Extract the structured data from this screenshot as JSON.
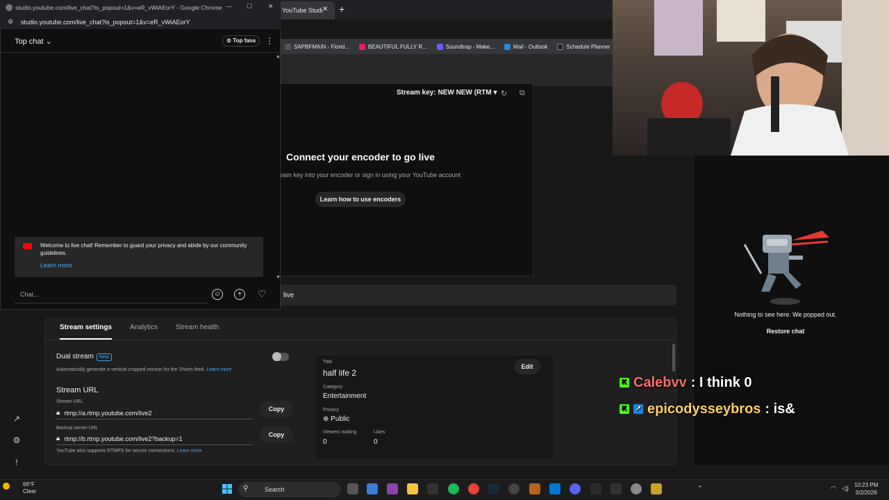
{
  "browser": {
    "tab_label": "YouTube Studi",
    "bookmarks": [
      {
        "label": "SAPBFMAIN - Florid...",
        "color": ""
      },
      {
        "label": "BEAUTIFUL FULLY R...",
        "color": "#e91e63"
      },
      {
        "label": "Soundtrap - Make...",
        "color": "#6a5cff"
      },
      {
        "label": "Mail - Outlook",
        "color": "#1e88e5"
      },
      {
        "label": "Schedule Planner",
        "color": "#222"
      }
    ]
  },
  "studio": {
    "stream_key": "Stream key: NEW NEW (RTM",
    "connect_title": "Connect your encoder to go live",
    "connect_sub": "te a stream key into your encoder or sign in using your YouTube account",
    "learn_encoders": "Learn how to use encoders",
    "golive_text": "live",
    "tabs": {
      "settings": "Stream settings",
      "analytics": "Analytics",
      "health": "Stream health"
    },
    "dual_stream": {
      "label": "Dual stream",
      "badge": "New",
      "desc": "Automatically generate a vertical cropped version for the Shorts feed.",
      "learn_more": "Learn more"
    },
    "stream_url": {
      "heading": "Stream URL",
      "field_label": "Stream URL",
      "value": "rtmp://a.rtmp.youtube.com/live2",
      "copy": "Copy",
      "backup_label": "Backup server URL",
      "backup_value": "rtmp://b.rtmp.youtube.com/live2?backup=1",
      "backup_copy": "Copy",
      "rtmps_note": "YouTube also supports RTMPS for secure connections.",
      "rtmps_link": "Learn more"
    },
    "info": {
      "title_label": "Title",
      "title": "half life 2",
      "edit": "Edit",
      "category_label": "Category",
      "category": "Entertainment",
      "privacy_label": "Privacy",
      "privacy": "Public",
      "viewers_label": "Viewers waiting",
      "viewers": "0",
      "likes_label": "Likes",
      "likes": "0"
    }
  },
  "right_chat": {
    "empty_text": "Nothing to see here. We popped out.",
    "restore": "Restore chat"
  },
  "overlay_chat": [
    {
      "user": "Calebvv",
      "message": ": I think 0",
      "user_color": "#ff6b6b"
    },
    {
      "user": "epicodysseybros",
      "message": ": is&",
      "user_color": "#ffd166"
    }
  ],
  "popout": {
    "window_title": "studio.youtube.com/live_chat?is_popout=1&v=eR_vWiAEorY - Google Chrome",
    "address": "studio.youtube.com/live_chat?is_popout=1&v=eR_vWiAEorY",
    "top_chat": "Top chat",
    "top_fans": "Top fans",
    "welcome": "Welcome to live chat! Remember to guard your privacy and abide by our community guidelines.",
    "learn_more": "Learn more",
    "chat_placeholder": "Chat..."
  },
  "taskbar": {
    "temp": "66°F",
    "weather": "Clear",
    "search": "Search",
    "time": "10:23 PM",
    "date": "3/2/2026"
  },
  "colors": {
    "accent": "#3ea6ff",
    "kick_green": "#53fc18"
  }
}
